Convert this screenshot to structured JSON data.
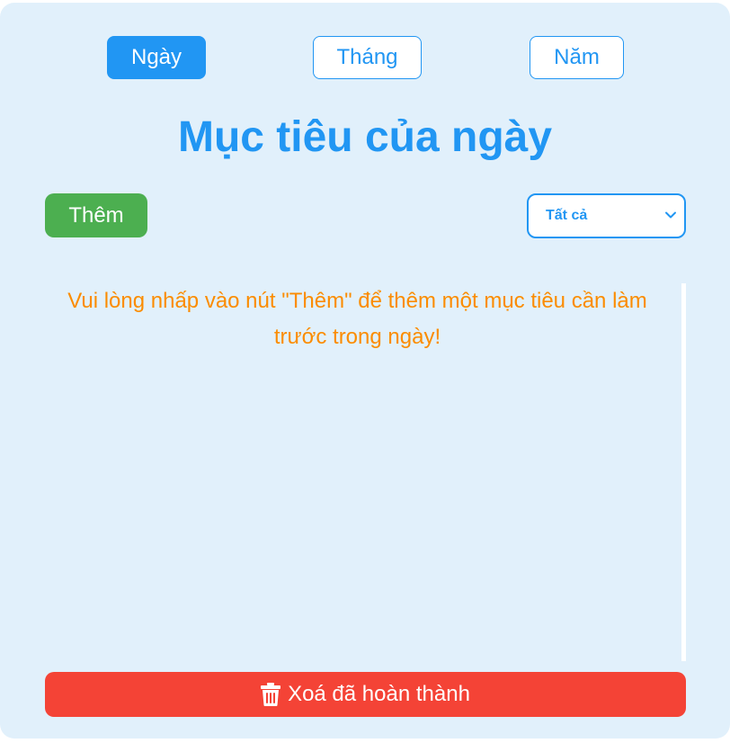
{
  "tabs": [
    {
      "label": "Ngày",
      "active": true
    },
    {
      "label": "Tháng",
      "active": false
    },
    {
      "label": "Năm",
      "active": false
    }
  ],
  "title": "Mục tiêu của ngày",
  "add_button_label": "Thêm",
  "filter": {
    "selected": "Tất cả",
    "icon": "chevron-down-icon"
  },
  "empty_message": "Vui lòng nhấp vào nút \"Thêm\" để thêm một mục tiêu cần làm trước trong ngày!",
  "clear_button": {
    "label": "Xoá đã hoàn thành",
    "icon": "trash-icon"
  },
  "colors": {
    "background": "#e1f0fb",
    "primary": "#2196f3",
    "add": "#4caf50",
    "warning_text": "#fb8c00",
    "danger": "#f44336"
  }
}
